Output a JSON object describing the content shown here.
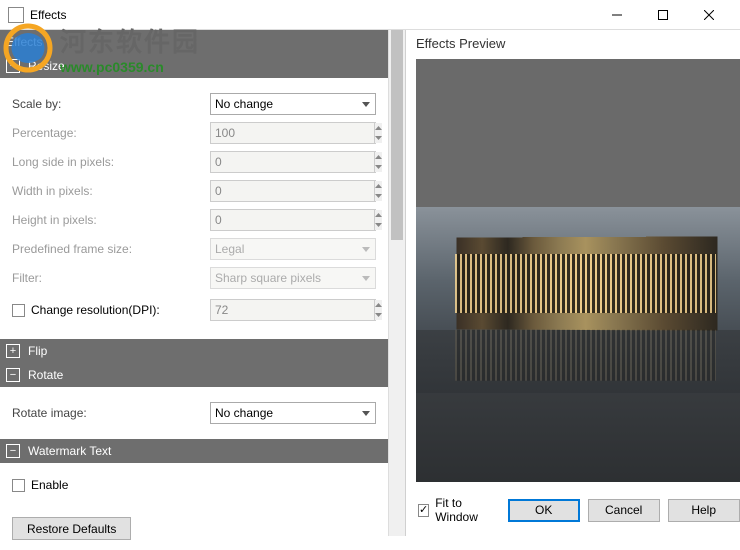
{
  "window": {
    "title": "Effects"
  },
  "watermark": {
    "cn": "河东软件园",
    "url": "www.pc0359.cn"
  },
  "sections": {
    "effects_header": "Effects",
    "resize": {
      "title": "Resize",
      "scale_by_label": "Scale by:",
      "scale_by_value": "No change",
      "percentage_label": "Percentage:",
      "percentage_value": "100",
      "long_side_label": "Long side in pixels:",
      "long_side_value": "0",
      "width_label": "Width in pixels:",
      "width_value": "0",
      "height_label": "Height in pixels:",
      "height_value": "0",
      "frame_label": "Predefined frame size:",
      "frame_value": "Legal",
      "filter_label": "Filter:",
      "filter_value": "Sharp square pixels",
      "dpi_label": "Change resolution(DPI):",
      "dpi_value": "72"
    },
    "flip": {
      "title": "Flip"
    },
    "rotate": {
      "title": "Rotate",
      "rotate_label": "Rotate image:",
      "rotate_value": "No change"
    },
    "watermark_text": {
      "title": "Watermark Text",
      "enable_label": "Enable"
    }
  },
  "buttons": {
    "restore_defaults": "Restore Defaults",
    "fit_to_window": "Fit to Window",
    "ok": "OK",
    "cancel": "Cancel",
    "help": "Help"
  },
  "preview": {
    "title": "Effects Preview"
  }
}
